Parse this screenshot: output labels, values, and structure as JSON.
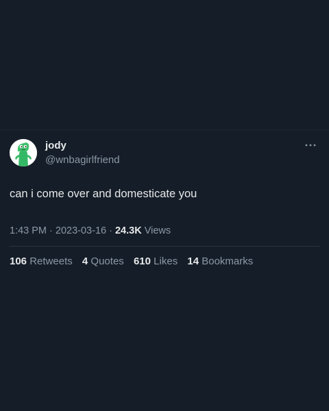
{
  "tweet": {
    "display_name": "jody",
    "handle": "@wnbagirlfriend",
    "text": "can i come over and domesticate you",
    "time": "1:43 PM",
    "separator": "·",
    "date": "2023-03-16",
    "views_count": "24.3K",
    "views_label": "Views"
  },
  "stats": {
    "retweets_count": "106",
    "retweets_label": "Retweets",
    "quotes_count": "4",
    "quotes_label": "Quotes",
    "likes_count": "610",
    "likes_label": "Likes",
    "bookmarks_count": "14",
    "bookmarks_label": "Bookmarks"
  },
  "icons": {
    "avatar": "green-gumby-figure-avatar",
    "more": "more-options-icon"
  },
  "colors": {
    "background": "#151d28",
    "primary_text": "#e7e9ea",
    "secondary_text": "#8b98a5",
    "divider": "#2a3441",
    "avatar_green": "#3cc06a"
  }
}
